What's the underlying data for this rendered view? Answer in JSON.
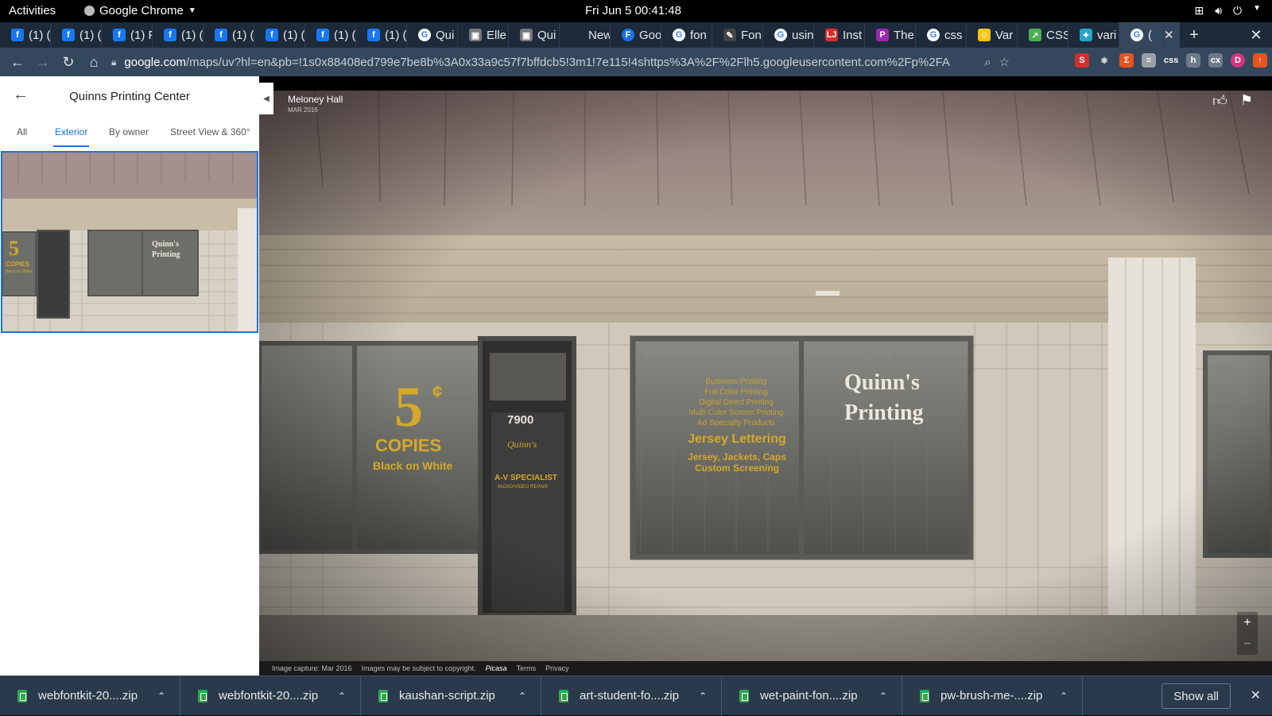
{
  "system_bar": {
    "activities": "Activities",
    "app_name": "Google Chrome",
    "clock": "Fri Jun 5  00:41:48"
  },
  "tabs": [
    {
      "icon": "facebook-icon",
      "label": "(1) (",
      "color": "#1877f2"
    },
    {
      "icon": "facebook-icon",
      "label": "(1) (",
      "color": "#1877f2"
    },
    {
      "icon": "facebook-icon",
      "label": "(1) F",
      "color": "#1877f2"
    },
    {
      "icon": "facebook-icon",
      "label": "(1) (",
      "color": "#1877f2"
    },
    {
      "icon": "facebook-icon",
      "label": "(1) (",
      "color": "#1877f2"
    },
    {
      "icon": "facebook-icon",
      "label": "(1) (",
      "color": "#1877f2"
    },
    {
      "icon": "facebook-icon",
      "label": "(1) (",
      "color": "#1877f2"
    },
    {
      "icon": "facebook-icon",
      "label": "(1) (",
      "color": "#1877f2"
    },
    {
      "icon": "google-icon",
      "label": "Qui",
      "color": "#ffffff"
    },
    {
      "icon": "cube-icon",
      "label": "Elle",
      "color": "#777777"
    },
    {
      "icon": "cube-icon",
      "label": "Qui",
      "color": "#777777"
    },
    {
      "icon": "blank-icon",
      "label": "New T",
      "color": "#1c2a3a"
    },
    {
      "icon": "f-circle-icon",
      "label": "Goo",
      "color": "#1a73e8"
    },
    {
      "icon": "google-icon",
      "label": "fon",
      "color": "#ffffff"
    },
    {
      "icon": "brush-icon",
      "label": "Fon",
      "color": "#444444"
    },
    {
      "icon": "google-icon",
      "label": "usin",
      "color": "#ffffff"
    },
    {
      "icon": "lj-icon",
      "label": "Inst",
      "color": "#d32f2f"
    },
    {
      "icon": "p-icon",
      "label": "The",
      "color": "#9c27b0"
    },
    {
      "icon": "google-icon",
      "label": "css",
      "color": "#ffffff"
    },
    {
      "icon": "smiley-icon",
      "label": "Var",
      "color": "#f5c518"
    },
    {
      "icon": "chart-icon",
      "label": "CSS",
      "color": "#4caf50"
    },
    {
      "icon": "bird-icon",
      "label": "vari",
      "color": "#2aa4c9"
    }
  ],
  "active_tab": {
    "icon": "google-icon",
    "label": "("
  },
  "address_bar": {
    "host": "google.com",
    "path": "/maps/uv?hl=en&pb=!1s0x88408ed799e7be8b%3A0x33a9c57f7bffdcb5!3m1!7e115!4shttps%3A%2F%2Flh5.googleusercontent.com%2Fp%2FAF1Qip..."
  },
  "extensions": [
    {
      "name": "s-ext-icon",
      "glyph": "S",
      "color": "#d32f2f"
    },
    {
      "name": "react-ext-icon",
      "glyph": "⚛",
      "color": "#35475c"
    },
    {
      "name": "sigma-ext-icon",
      "glyph": "Σ",
      "color": "#e8541e"
    },
    {
      "name": "list-ext-icon",
      "glyph": "≡",
      "color": "#9aa0a6"
    },
    {
      "name": "css-ext-icon",
      "glyph": "css",
      "color": "#35475c"
    },
    {
      "name": "h-ext-icon",
      "glyph": "h",
      "color": "#6d7a88"
    },
    {
      "name": "cm-ext-icon",
      "glyph": "cx",
      "color": "#6d7a88"
    },
    {
      "name": "profile-avatar-icon",
      "glyph": "D",
      "color": "#d6337c"
    },
    {
      "name": "update-icon",
      "glyph": "↑",
      "color": "#e8541e"
    }
  ],
  "panel": {
    "title": "Quinns Printing Center",
    "filters": [
      "All",
      "Exterior",
      "By owner",
      "Street View & 360°"
    ],
    "active_filter": "Exterior"
  },
  "thumbnail": {
    "sign_5c": "5",
    "sign_copies": "COPIES",
    "sign_bw": "Black on White",
    "sign_quinns": "Quinn's",
    "sign_printing": "Printing"
  },
  "photo": {
    "author": "Meloney Hall",
    "date": "MAR 2016",
    "big_5": "5",
    "cents": "¢",
    "copies": "COPIES",
    "black_white": "Black on White",
    "door_number": "7900",
    "door_script": "Quinn's",
    "av_specialist": "A-V SPECIALIST",
    "av_repair": "AUDIO/VIDEO REPAIR",
    "services": [
      "Business Printing",
      "Full Color Printing",
      "Digital Direct Printing",
      "Multi Color Screen Printing",
      "Ad Specialty Products"
    ],
    "jersey": "Jersey Lettering",
    "jersey_sub1": "Jersey, Jackets, Caps",
    "jersey_sub2": "Custom Screening",
    "quinns": "Quinn's",
    "printing": "Printing"
  },
  "footer": {
    "capture": "Image capture: Mar 2016",
    "copyright": "Images may be subject to copyright.",
    "brand": "Picasa",
    "terms": "Terms",
    "privacy": "Privacy"
  },
  "downloads": [
    "webfontkit-20....zip",
    "webfontkit-20....zip",
    "kaushan-script.zip",
    "art-student-fo....zip",
    "wet-paint-fon....zip",
    "pw-brush-me-....zip"
  ],
  "show_all": "Show all"
}
